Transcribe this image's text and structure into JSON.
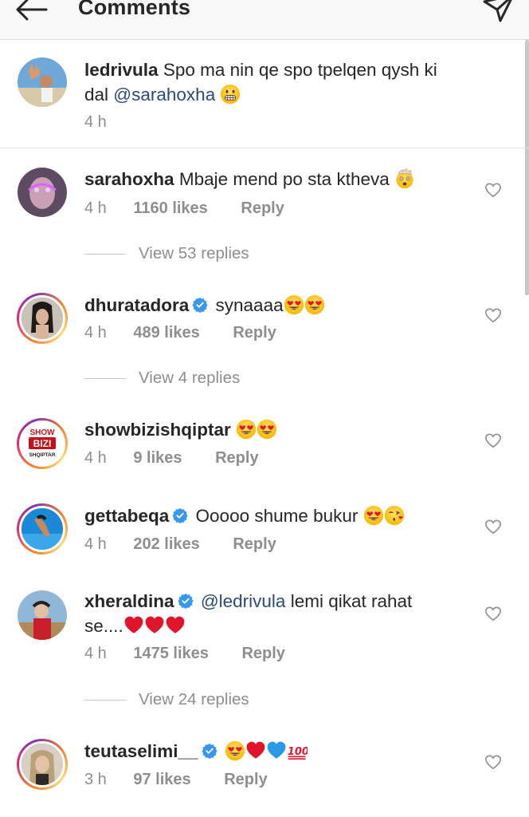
{
  "header": {
    "title": "Comments",
    "back_icon": "arrow-left-icon",
    "send_icon": "paper-plane-icon"
  },
  "caption": {
    "username": "ledrivula",
    "text_before": "Spo ma nin qe spo tpelqen qysh ki dal",
    "mention": "@sarahoxha",
    "emoji": "grimacing-face",
    "time": "4 h"
  },
  "comments": [
    {
      "username": "sarahoxha",
      "verified": false,
      "text": "Mbaje mend po sta ktheva",
      "emoji": "exploding-head",
      "time": "4 h",
      "likes": "1160 likes",
      "reply": "Reply",
      "view_replies": "View 53 replies"
    },
    {
      "username": "dhuratadora",
      "verified": true,
      "text": "synaaaa",
      "emoji": "heart-eyes x2",
      "time": "4 h",
      "likes": "489 likes",
      "reply": "Reply",
      "view_replies": "View 4 replies"
    },
    {
      "username": "showbizishqiptar",
      "verified": false,
      "text": "",
      "emoji": "heart-eyes x2",
      "time": "4 h",
      "likes": "9 likes",
      "reply": "Reply",
      "avatar_text": [
        "SHOW",
        "BIZI",
        "SHQIPTAR"
      ]
    },
    {
      "username": "gettabeqa",
      "verified": true,
      "text": "Ooooo shume bukur",
      "emoji": "heart-eyes, kissing-face",
      "time": "4 h",
      "likes": "202 likes",
      "reply": "Reply"
    },
    {
      "username": "xheraldina",
      "verified": true,
      "mention": "@ledrivula",
      "text": "lemi qikat rahat",
      "text_line2": "se....",
      "emoji": "red-heart x3",
      "time": "4 h",
      "likes": "1475 likes",
      "reply": "Reply",
      "view_replies": "View 24 replies"
    },
    {
      "username": "teutaselimi__",
      "verified": true,
      "text": "",
      "emoji": "heart-eyes, red-heart, blue-heart, hundred-points",
      "time": "3 h",
      "likes": "97 likes",
      "reply": "Reply"
    }
  ],
  "colors": {
    "text": "#262626",
    "secondary": "#8e8e8e",
    "mention": "#2c4a78",
    "verified": "#3897f0",
    "header_bg": "#f8f8f8"
  }
}
